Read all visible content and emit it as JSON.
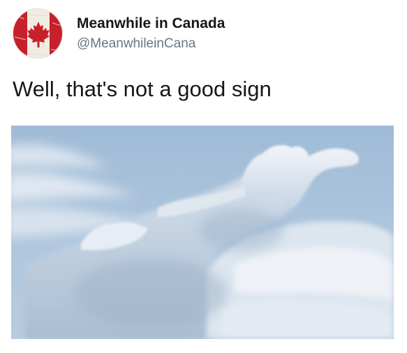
{
  "tweet": {
    "display_name": "Meanwhile in Canada",
    "handle": "@MeanwhileinCana",
    "text": "Well, that's not a good sign"
  },
  "avatar": {
    "icon": "canada-flag-icon",
    "flag_red": "#c8202a",
    "flag_white": "#f1ece2"
  },
  "media": {
    "icon": "cloud-photo",
    "sky_color": "#a9c3dc"
  }
}
